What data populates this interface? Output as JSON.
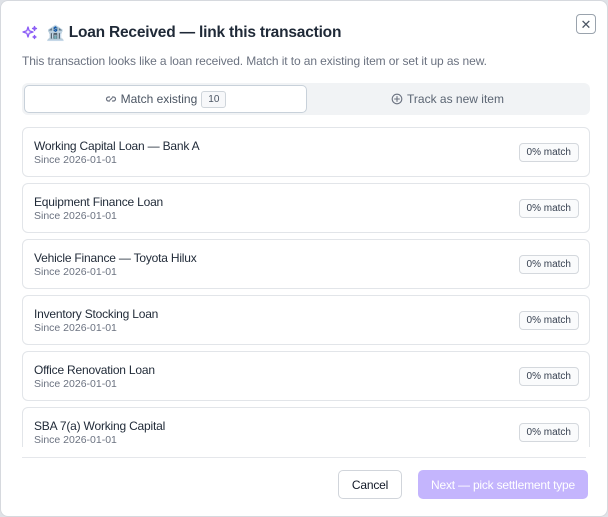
{
  "dialog": {
    "bank_emoji": "🏦",
    "title": "Loan Received — link this transaction",
    "subtitle": "This transaction looks like a loan received. Match it to an existing item or set it up as new.",
    "close_symbol": "✕"
  },
  "tabs": {
    "match_label": "Match existing",
    "match_count": "10",
    "track_label": "Track as new item"
  },
  "items": [
    {
      "name": "Working Capital Loan — Bank A",
      "since": "Since 2026-01-01",
      "match": "0% match"
    },
    {
      "name": "Equipment Finance Loan",
      "since": "Since 2026-01-01",
      "match": "0% match"
    },
    {
      "name": "Vehicle Finance — Toyota Hilux",
      "since": "Since 2026-01-01",
      "match": "0% match"
    },
    {
      "name": "Inventory Stocking Loan",
      "since": "Since 2026-01-01",
      "match": "0% match"
    },
    {
      "name": "Office Renovation Loan",
      "since": "Since 2026-01-01",
      "match": "0% match"
    },
    {
      "name": "SBA 7(a) Working Capital",
      "since": "Since 2026-01-01",
      "match": "0% match"
    }
  ],
  "footer": {
    "cancel_label": "Cancel",
    "next_label": "Next — pick settlement type"
  },
  "colors": {
    "accent": "#8b5cf6",
    "next_disabled": "#c4b5fd"
  }
}
